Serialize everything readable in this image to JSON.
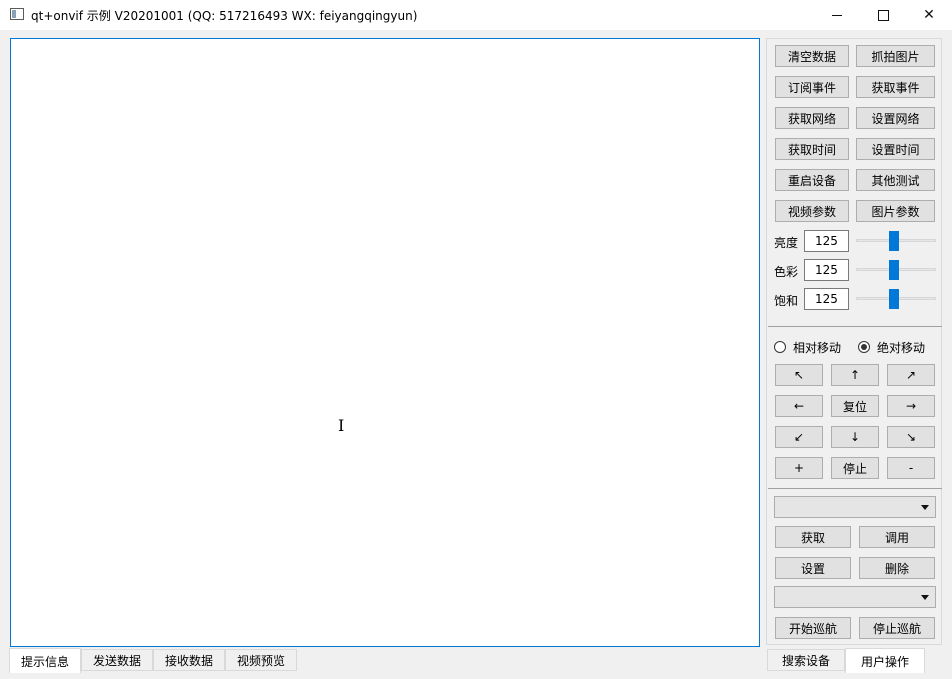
{
  "window": {
    "title": "qt+onvif 示例 V20201001 (QQ: 517216493 WX: feiyangqingyun)"
  },
  "buttons": {
    "clear_data": "清空数据",
    "capture_image": "抓拍图片",
    "subscribe_event": "订阅事件",
    "get_event": "获取事件",
    "get_network": "获取网络",
    "set_network": "设置网络",
    "get_time": "获取时间",
    "set_time": "设置时间",
    "reboot_device": "重启设备",
    "other_test": "其他测试",
    "video_params": "视频参数",
    "image_params": "图片参数"
  },
  "image_settings": {
    "brightness_label": "亮度",
    "brightness_value": "125",
    "brightness_level": 0.5,
    "color_label": "色彩",
    "color_value": "125",
    "color_level": 0.5,
    "saturation_label": "饱和",
    "saturation_value": "125",
    "saturation_level": 0.5
  },
  "ptz": {
    "relative_move": "相对移动",
    "absolute_move": "绝对移动",
    "selected": "absolute",
    "up_left": "↖",
    "up": "↑",
    "up_right": "↗",
    "left": "←",
    "reset": "复位",
    "right": "→",
    "down_left": "↙",
    "down": "↓",
    "down_right": "↘",
    "zoom_in": "+",
    "stop": "停止",
    "zoom_out": "-"
  },
  "preset": {
    "get": "获取",
    "call": "调用",
    "set": "设置",
    "delete": "删除"
  },
  "cruise": {
    "start": "开始巡航",
    "stop": "停止巡航"
  },
  "bottom_tabs": [
    "提示信息",
    "发送数据",
    "接收数据",
    "视频预览"
  ],
  "side_tabs": [
    "搜索设备",
    "用户操作"
  ],
  "active_bottom_tab": "提示信息",
  "active_side_tab": "用户操作"
}
